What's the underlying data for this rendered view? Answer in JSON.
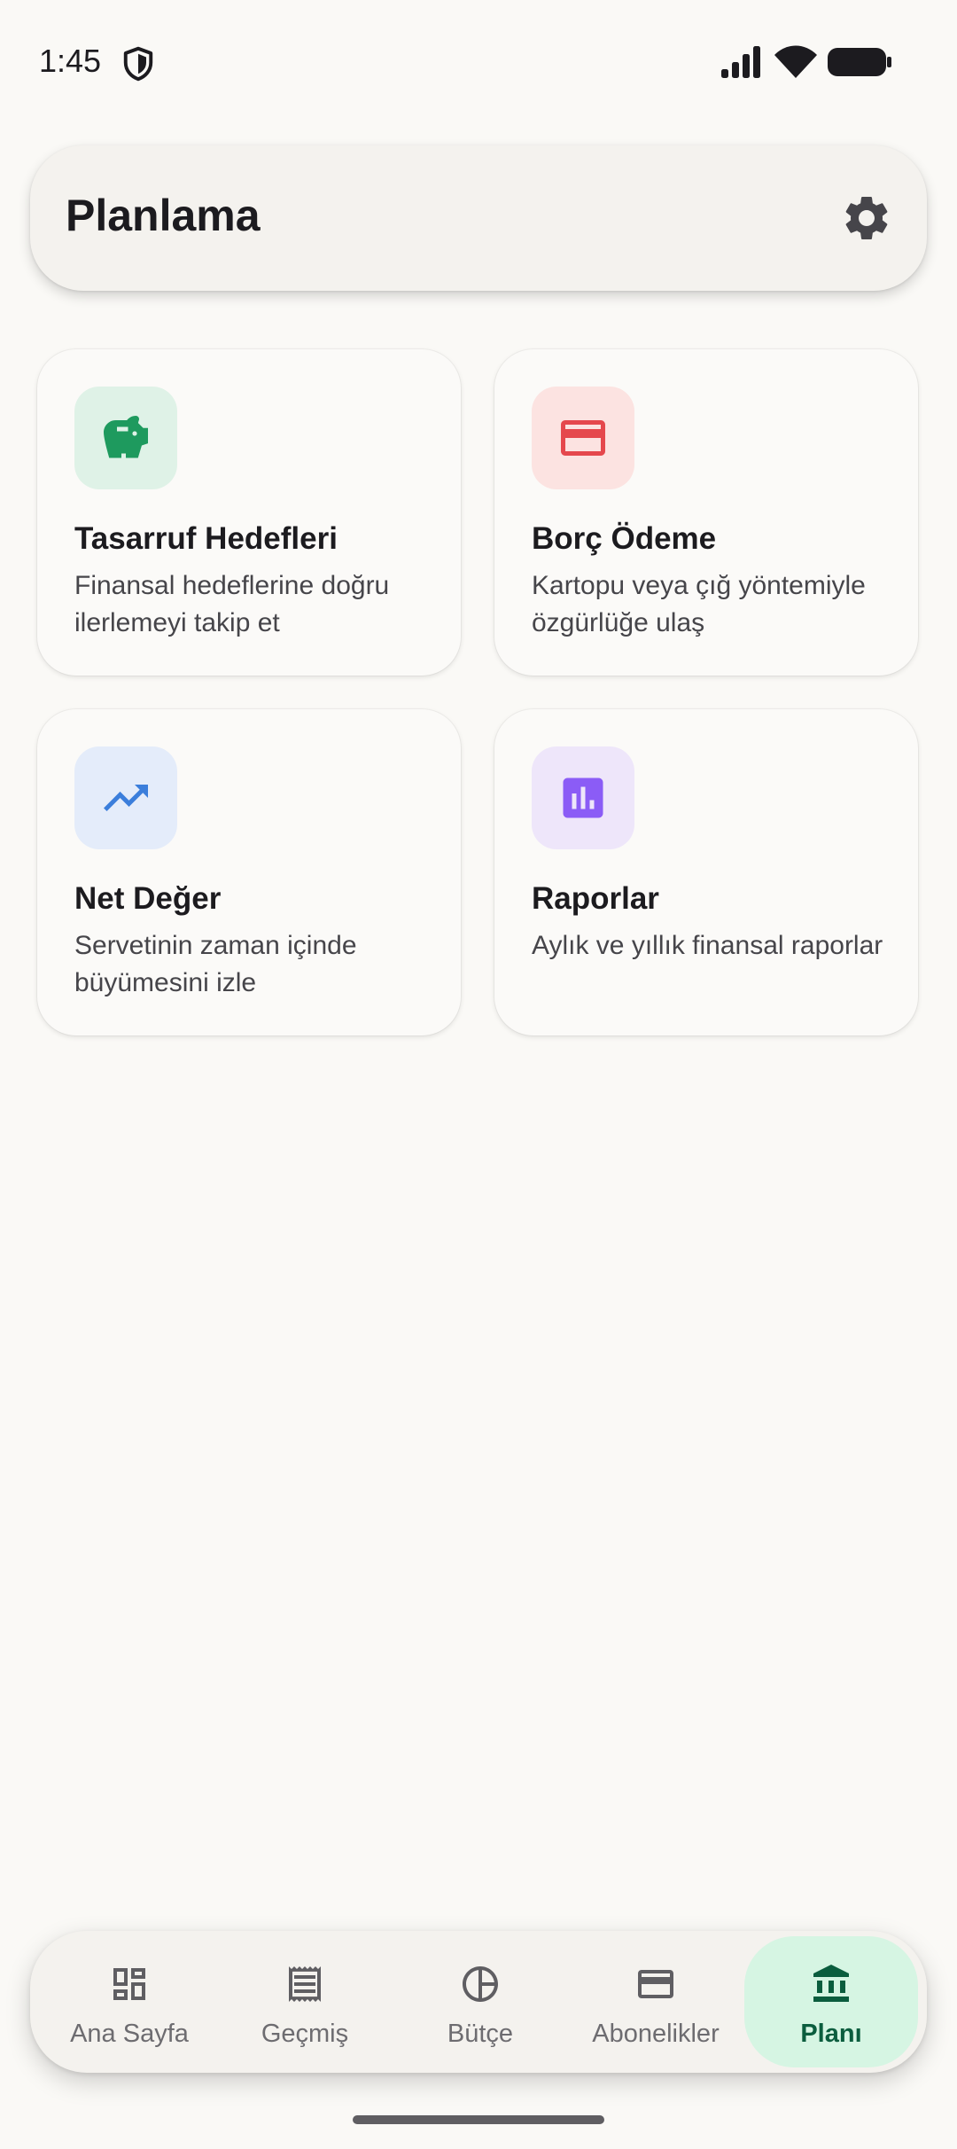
{
  "status_bar": {
    "time": "1:45"
  },
  "header": {
    "title": "Planlama"
  },
  "cards": [
    {
      "title": "Tasarruf Hedefleri",
      "description": "Finansal hedeflerine doğru ilerlemeyi takip et",
      "icon": "piggy-bank-icon",
      "icon_color": "#1E9A5E",
      "icon_bg": "#DFF2E7"
    },
    {
      "title": "Borç Ödeme",
      "description": "Kartopu veya çığ yöntemiyle özgürlüğe ulaş",
      "icon": "credit-card-icon",
      "icon_color": "#E5484D",
      "icon_bg": "#FCE3E1"
    },
    {
      "title": "Net Değer",
      "description": "Servetinin zaman içinde büyümesini izle",
      "icon": "trending-up-icon",
      "icon_color": "#3B7EDB",
      "icon_bg": "#E4ECFA"
    },
    {
      "title": "Raporlar",
      "description": "Aylık ve yıllık finansal raporlar",
      "icon": "bar-chart-icon",
      "icon_color": "#8B5CF6",
      "icon_bg": "#EEE6FA"
    }
  ],
  "bottom_nav": {
    "items": [
      {
        "label": "Ana Sayfa",
        "icon": "dashboard-icon"
      },
      {
        "label": "Geçmiş",
        "icon": "receipt-icon"
      },
      {
        "label": "Bütçe",
        "icon": "pie-chart-icon"
      },
      {
        "label": "Abonelikler",
        "icon": "credit-card-icon"
      },
      {
        "label": "Planı",
        "icon": "bank-icon"
      }
    ],
    "active_label": "Planı",
    "active_color": "#0B5D3E",
    "active_bg": "#D6F5E3"
  }
}
